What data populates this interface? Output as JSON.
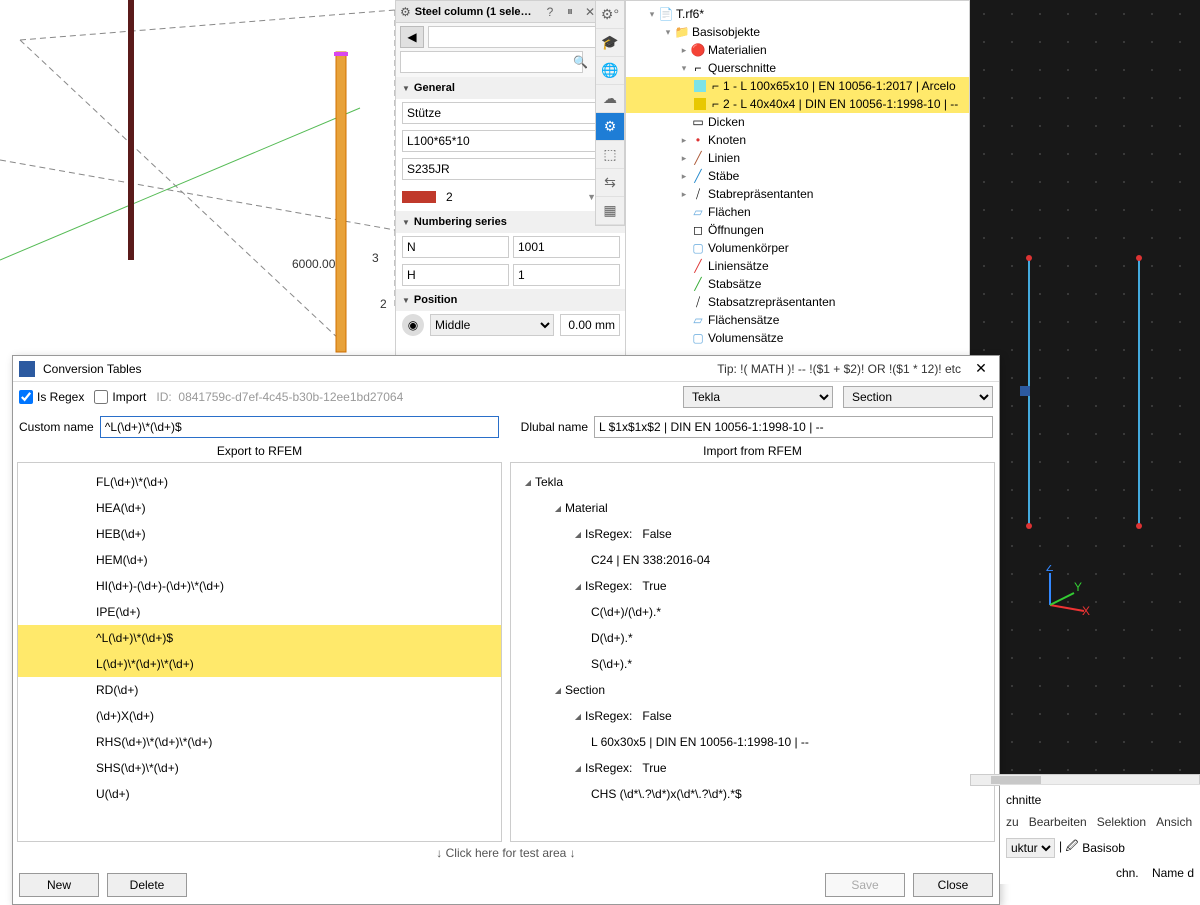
{
  "steel_panel": {
    "title": "Steel column (1 sele…",
    "general_h": "General",
    "name_val": "Stütze",
    "profile_val": "L100*65*10",
    "material_val": "S235JR",
    "color_num": "2",
    "color_hex": "#c0392b",
    "numbering_h": "Numbering series",
    "num_prefix": "N",
    "num_start": "1001",
    "num_prefix2": "H",
    "num_start2": "1",
    "position_h": "Position",
    "pos_mode": "Middle",
    "pos_offset": "0.00 mm"
  },
  "bg_left": {
    "dim": "6000.00"
  },
  "navigator": {
    "root": "T.rf6*",
    "basis": "Basisobjekte",
    "materialien": "Materialien",
    "querschnitte": "Querschnitte",
    "qs1": "1 - L 100x65x10 | EN 10056-1:2017 | Arcelo",
    "qs2": "2 - L 40x40x4 | DIN EN 10056-1:1998-10 | --",
    "dicken": "Dicken",
    "knoten": "Knoten",
    "linien": "Linien",
    "staebe": "Stäbe",
    "stabrepr": "Stabrepräsentanten",
    "flaechen": "Flächen",
    "oeffnungen": "Öffnungen",
    "volumenkoerper": "Volumenkörper",
    "liniensaetze": "Liniensätze",
    "stabsaetze": "Stabsätze",
    "stabsatzrepr": "Stabsatzrepräsentanten",
    "flaechensaetze": "Flächensätze",
    "volumensaetze": "Volumensätze"
  },
  "dialog": {
    "title": "Conversion Tables",
    "tip": "Tip: !( MATH )! -- !($1 + $2)! OR !($1 * 12)! etc",
    "is_regex": "Is Regex",
    "import": "Import",
    "id_label": "ID:",
    "id_val": "0841759c-d7ef-4c45-b30b-12ee1bd27064",
    "dd_sw": "Tekla",
    "dd_cat": "Section",
    "custom_label": "Custom name",
    "custom_val": "^L(\\d+)\\*(\\d+)$",
    "dlubal_label": "Dlubal name",
    "dlubal_val": "L $1x$1x$2 | DIN EN 10056-1:1998-10 | --",
    "col_export_h": "Export to RFEM",
    "col_import_h": "Import from RFEM",
    "export_items": [
      "FL(\\d+)\\*(\\d+)",
      "HEA(\\d+)",
      "HEB(\\d+)",
      "HEM(\\d+)",
      "HI(\\d+)-(\\d+)-(\\d+)\\*(\\d+)",
      "IPE(\\d+)",
      "^L(\\d+)\\*(\\d+)$",
      "L(\\d+)\\*(\\d+)\\*(\\d+)",
      "RD(\\d+)",
      "(\\d+)X(\\d+)",
      "RHS(\\d+)\\*(\\d+)\\*(\\d+)",
      "SHS(\\d+)\\*(\\d+)",
      "U(\\d+)"
    ],
    "import_root": "Tekla",
    "imp_material": "Material",
    "imp_isregex": "IsRegex:",
    "imp_false": "False",
    "imp_true": "True",
    "imp_c24": "C24 | EN 338:2016-04",
    "imp_c": "C(\\d+)/(\\d+).*",
    "imp_d": "D(\\d+).*",
    "imp_s": "S(\\d+).*",
    "imp_section": "Section",
    "imp_l60": "L 60x30x5 | DIN EN 10056-1:1998-10 | --",
    "imp_chs": "CHS (\\d*\\.?\\d*)x(\\d*\\.?\\d*).*$",
    "testbar": "↓ Click here for test area ↓",
    "btn_new": "New",
    "btn_delete": "Delete",
    "btn_save": "Save",
    "btn_close": "Close"
  },
  "frag": {
    "schnitte": "chnitte",
    "zu": "zu",
    "bearbeiten": "Bearbeiten",
    "selektion": "Selektion",
    "ansich": "Ansich",
    "uktur": "uktur",
    "basisob": "Basisob",
    "name": "Name d",
    "chn": "chn."
  }
}
